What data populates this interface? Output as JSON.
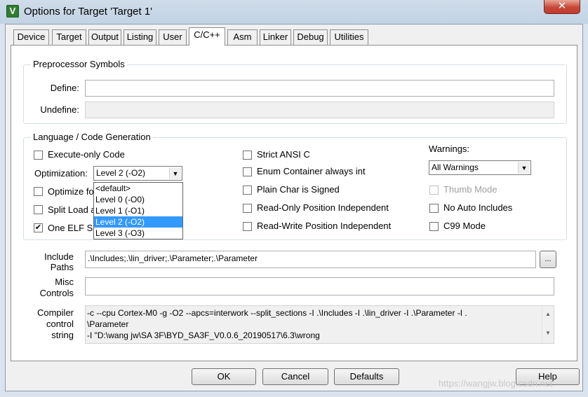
{
  "window": {
    "title": "Options for Target 'Target 1'",
    "close_glyph": "✕",
    "app_icon_glyph": "V"
  },
  "tabs": [
    {
      "label": "Device"
    },
    {
      "label": "Target"
    },
    {
      "label": "Output"
    },
    {
      "label": "Listing"
    },
    {
      "label": "User"
    },
    {
      "label": "C/C++"
    },
    {
      "label": "Asm"
    },
    {
      "label": "Linker"
    },
    {
      "label": "Debug"
    },
    {
      "label": "Utilities"
    }
  ],
  "preprocessor": {
    "title": "Preprocessor Symbols",
    "define_label": "Define:",
    "define_value": "",
    "undefine_label": "Undefine:",
    "undefine_value": ""
  },
  "language": {
    "title": "Language / Code Generation",
    "execute_only": {
      "label": "Execute-only Code",
      "checked": false
    },
    "optimization_label": "Optimization:",
    "optimization_value": "Level 2 (-O2)",
    "optimization_options": [
      "<default>",
      "Level 0 (-O0)",
      "Level 1 (-O1)",
      "Level 2 (-O2)",
      "Level 3 (-O3)"
    ],
    "optimize_for_time": {
      "label": "Optimize fo",
      "checked": false
    },
    "split_load": {
      "label": "Split Load a",
      "checked": false
    },
    "one_elf": {
      "label": "One ELF S",
      "checked": true,
      "mark": "✔"
    },
    "strict_ansi": {
      "label": "Strict ANSI C",
      "checked": false
    },
    "enum_container": {
      "label": "Enum Container always int",
      "checked": false
    },
    "plain_char": {
      "label": "Plain Char is Signed",
      "checked": false
    },
    "ropi": {
      "label": "Read-Only Position Independent",
      "checked": false
    },
    "rwpi": {
      "label": "Read-Write Position Independent",
      "checked": false
    },
    "warnings_label": "Warnings:",
    "warnings_value": "All Warnings",
    "thumb_mode": {
      "label": "Thumb Mode",
      "checked": false,
      "disabled": true
    },
    "no_auto_includes": {
      "label": "No Auto Includes",
      "checked": false
    },
    "c99_mode": {
      "label": "C99 Mode",
      "checked": false
    }
  },
  "paths": {
    "include_label_1": "Include",
    "include_label_2": "Paths",
    "include_value": ".\\Includes;.\\lin_driver;.\\Parameter;.\\Parameter",
    "browse_label": "...",
    "misc_label_1": "Misc",
    "misc_label_2": "Controls",
    "misc_value": "",
    "compiler_label_1": "Compiler",
    "compiler_label_2": "control",
    "compiler_label_3": "string",
    "compiler_lines": [
      "-c --cpu Cortex-M0 -g -O2 --apcs=interwork --split_sections -I .\\Includes -I .\\lin_driver -I .\\Parameter -I .",
      "\\Parameter",
      "-I \"D:\\wang jw\\SA 3F\\BYD_SA3F_V0.0.6_20190517\\6.3\\wrong"
    ]
  },
  "buttons": {
    "ok": "OK",
    "cancel": "Cancel",
    "defaults": "Defaults",
    "help": "Help"
  },
  "watermark": "https://wangjw.blog.csdn.net",
  "icons": {
    "dropdown_arrow": "▼",
    "scroll_up": "▲",
    "scroll_down": "▼"
  }
}
